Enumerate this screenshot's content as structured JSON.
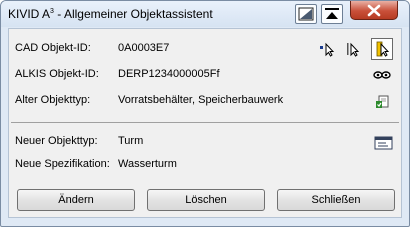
{
  "window": {
    "title_main": "KIVID A",
    "title_sup": "3",
    "title_rest": " - Allgemeiner Objektassistent"
  },
  "fields": {
    "cad_label": "CAD Objekt-ID:",
    "cad_value": "0A0003E7",
    "alkis_label": "ALKIS Objekt-ID:",
    "alkis_value": "DERP1234000005Ff",
    "alter_label": "Alter Objekttyp:",
    "alter_value": "Vorratsbehälter, Speicherbauwerk",
    "neuer_label": "Neuer Objekttyp:",
    "neuer_value": "Turm",
    "spez_label": "Neue Spezifikation:",
    "spez_value": "Wasserturm"
  },
  "buttons": {
    "aendern": "Ändern",
    "loeschen": "Löschen",
    "schliessen": "Schließen"
  },
  "icons": {
    "titlebar": [
      "window-layout-icon",
      "pin-top-icon",
      "close-icon"
    ],
    "cad_row": [
      "pick-point-cursor-icon",
      "pick-cursor-icon",
      "pick-object-cursor-icon"
    ],
    "alkis_row": [
      "view-eye-icon"
    ],
    "alter_row": [
      "copy-type-icon"
    ],
    "neuer_row": [
      "select-list-icon"
    ]
  }
}
